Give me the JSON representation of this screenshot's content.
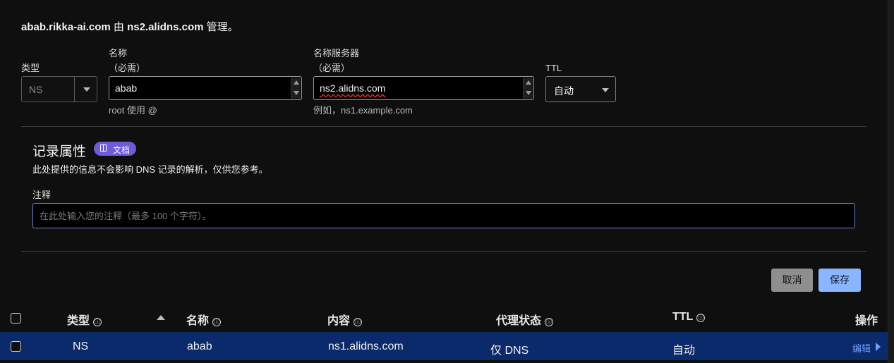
{
  "heading": {
    "domain": "abab.rikka-ai.com",
    "by": " 由 ",
    "ns": "ns2.alidns.com",
    "suffix": " 管理。"
  },
  "form": {
    "type": {
      "label": "类型",
      "value": "NS"
    },
    "name": {
      "label": "名称",
      "required": "（必需）",
      "value": "abab",
      "hint": "root 使用 @"
    },
    "nameserver": {
      "label": "名称服务器",
      "required": "（必需）",
      "value": "ns2.alidns.com",
      "hint": "例如，ns1.example.com"
    },
    "ttl": {
      "label": "TTL",
      "value": "自动"
    }
  },
  "record_attributes": {
    "title": "记录属性",
    "doc_badge": "文档",
    "doc_icon": "book-icon",
    "description": "此处提供的信息不会影响 DNS 记录的解析，仅供您参考。",
    "note_label": "注释",
    "note_placeholder": "在此处输入您的注释（最多 100 个字符）。"
  },
  "buttons": {
    "cancel": "取消",
    "save": "保存"
  },
  "table": {
    "columns": [
      {
        "label": "类型",
        "info": "ⓘ"
      },
      {
        "label": "名称",
        "info": "ⓘ"
      },
      {
        "label": "内容",
        "info": "ⓘ"
      },
      {
        "label": "代理状态",
        "info": "ⓘ"
      },
      {
        "label": "TTL",
        "info": "ⓘ"
      },
      {
        "label": "操作"
      }
    ],
    "rows": [
      {
        "type": "NS",
        "name": "abab",
        "content": "ns1.alidns.com",
        "proxy": "仅 DNS",
        "ttl": "自动",
        "action": "编辑"
      }
    ]
  },
  "colors": {
    "accent": "#8bb6ff",
    "badge": "#6d5cd6",
    "selected_row": "#0b2a6b",
    "link": "#6ea2ff"
  }
}
